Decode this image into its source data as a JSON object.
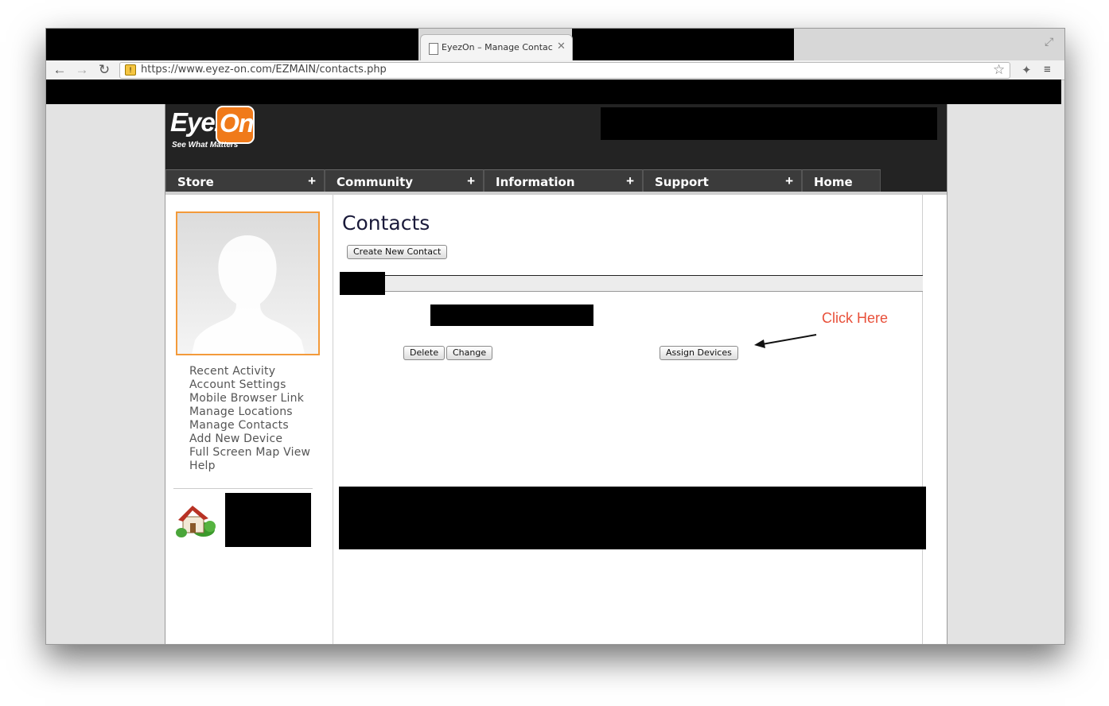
{
  "browser": {
    "tab_title": "EyezOn – Manage Contacts",
    "close_glyph": "✕",
    "url": "https://www.eyez-on.com/EZMAIN/contacts.php",
    "back_glyph": "←",
    "forward_glyph": "→",
    "reload_glyph": "↻",
    "star_glyph": "☆",
    "fullscreen_glyph": "⤢",
    "menu_glyph": "≡"
  },
  "logo": {
    "word1": "Eyez",
    "word2": "On",
    "tagline": "See What Matters"
  },
  "nav": {
    "items": [
      {
        "label": "Store",
        "expand": "+"
      },
      {
        "label": "Community",
        "expand": "+"
      },
      {
        "label": "Information",
        "expand": "+"
      },
      {
        "label": "Support",
        "expand": "+"
      },
      {
        "label": "Home"
      }
    ]
  },
  "sidebar": {
    "links": [
      "Recent Activity",
      "Account Settings",
      "Mobile Browser Link",
      "Manage Locations",
      "Manage Contacts",
      "Add New Device",
      "Full Screen Map View",
      "Help"
    ]
  },
  "main": {
    "title": "Contacts",
    "create_button": "Create New Contact",
    "delete_button": "Delete",
    "change_button": "Change",
    "assign_button": "Assign Devices",
    "annotation": "Click Here"
  },
  "colors": {
    "accent_orange": "#f07a1a",
    "annotation_red": "#e8503a",
    "header_bg": "#232323"
  }
}
